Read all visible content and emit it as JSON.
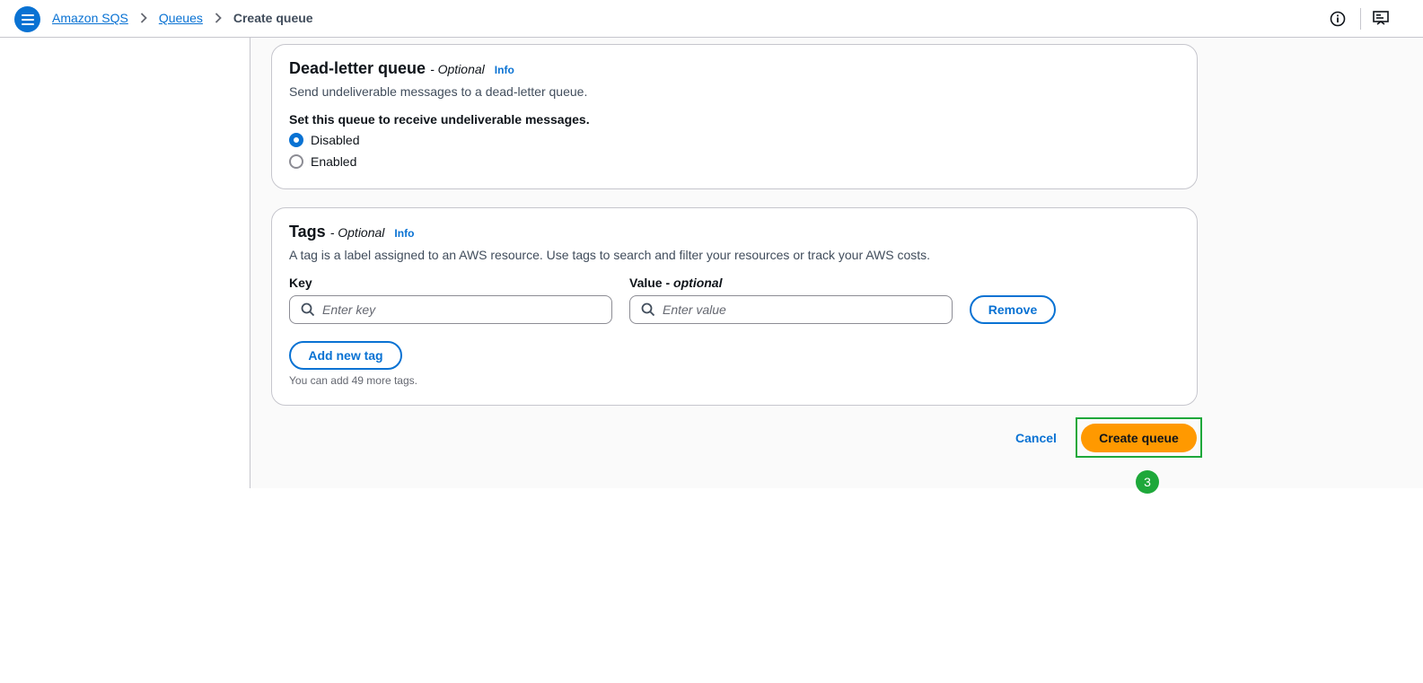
{
  "breadcrumb": {
    "items": [
      "Amazon SQS",
      "Queues"
    ],
    "current": "Create queue"
  },
  "dead_letter": {
    "title": "Dead-letter queue",
    "optional": "- Optional",
    "info": "Info",
    "description": "Send undeliverable messages to a dead-letter queue.",
    "question": "Set this queue to receive undeliverable messages.",
    "options": [
      "Disabled",
      "Enabled"
    ],
    "selected": "Disabled"
  },
  "tags": {
    "title": "Tags",
    "optional": "- Optional",
    "info": "Info",
    "description": "A tag is a label assigned to an AWS resource. Use tags to search and filter your resources or track your AWS costs.",
    "key_label": "Key",
    "value_label": "Value",
    "value_optional": "optional",
    "key_placeholder": "Enter key",
    "value_placeholder": "Enter value",
    "remove_label": "Remove",
    "add_label": "Add new tag",
    "hint": "You can add 49 more tags."
  },
  "footer": {
    "cancel_label": "Cancel",
    "create_label": "Create queue",
    "step_number": "3"
  },
  "colors": {
    "accent": "#0972d3",
    "primary_button": "#ff9900",
    "highlight": "#1ea83a"
  }
}
